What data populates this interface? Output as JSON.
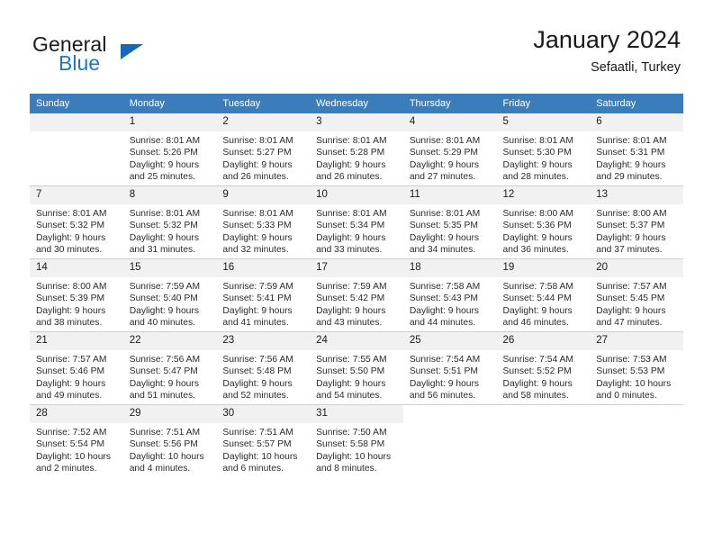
{
  "brand": {
    "name_part1": "General",
    "name_part2": "Blue",
    "triangle_color": "#1669b2",
    "blue_color": "#1f77c2"
  },
  "header": {
    "title": "January 2024",
    "subtitle": "Sefaatli, Turkey"
  },
  "theme": {
    "header_row_bg": "#3b7cbb",
    "daynum_bg": "#f1f1f1",
    "grid_line": "#cfcfcf",
    "text": "#1a1a1a"
  },
  "weekday_headers": [
    "Sunday",
    "Monday",
    "Tuesday",
    "Wednesday",
    "Thursday",
    "Friday",
    "Saturday"
  ],
  "weeks": [
    [
      {
        "day": "",
        "lines": []
      },
      {
        "day": "1",
        "lines": [
          "Sunrise: 8:01 AM",
          "Sunset: 5:26 PM",
          "Daylight: 9 hours",
          "and 25 minutes."
        ]
      },
      {
        "day": "2",
        "lines": [
          "Sunrise: 8:01 AM",
          "Sunset: 5:27 PM",
          "Daylight: 9 hours",
          "and 26 minutes."
        ]
      },
      {
        "day": "3",
        "lines": [
          "Sunrise: 8:01 AM",
          "Sunset: 5:28 PM",
          "Daylight: 9 hours",
          "and 26 minutes."
        ]
      },
      {
        "day": "4",
        "lines": [
          "Sunrise: 8:01 AM",
          "Sunset: 5:29 PM",
          "Daylight: 9 hours",
          "and 27 minutes."
        ]
      },
      {
        "day": "5",
        "lines": [
          "Sunrise: 8:01 AM",
          "Sunset: 5:30 PM",
          "Daylight: 9 hours",
          "and 28 minutes."
        ]
      },
      {
        "day": "6",
        "lines": [
          "Sunrise: 8:01 AM",
          "Sunset: 5:31 PM",
          "Daylight: 9 hours",
          "and 29 minutes."
        ]
      }
    ],
    [
      {
        "day": "7",
        "lines": [
          "Sunrise: 8:01 AM",
          "Sunset: 5:32 PM",
          "Daylight: 9 hours",
          "and 30 minutes."
        ]
      },
      {
        "day": "8",
        "lines": [
          "Sunrise: 8:01 AM",
          "Sunset: 5:32 PM",
          "Daylight: 9 hours",
          "and 31 minutes."
        ]
      },
      {
        "day": "9",
        "lines": [
          "Sunrise: 8:01 AM",
          "Sunset: 5:33 PM",
          "Daylight: 9 hours",
          "and 32 minutes."
        ]
      },
      {
        "day": "10",
        "lines": [
          "Sunrise: 8:01 AM",
          "Sunset: 5:34 PM",
          "Daylight: 9 hours",
          "and 33 minutes."
        ]
      },
      {
        "day": "11",
        "lines": [
          "Sunrise: 8:01 AM",
          "Sunset: 5:35 PM",
          "Daylight: 9 hours",
          "and 34 minutes."
        ]
      },
      {
        "day": "12",
        "lines": [
          "Sunrise: 8:00 AM",
          "Sunset: 5:36 PM",
          "Daylight: 9 hours",
          "and 36 minutes."
        ]
      },
      {
        "day": "13",
        "lines": [
          "Sunrise: 8:00 AM",
          "Sunset: 5:37 PM",
          "Daylight: 9 hours",
          "and 37 minutes."
        ]
      }
    ],
    [
      {
        "day": "14",
        "lines": [
          "Sunrise: 8:00 AM",
          "Sunset: 5:39 PM",
          "Daylight: 9 hours",
          "and 38 minutes."
        ]
      },
      {
        "day": "15",
        "lines": [
          "Sunrise: 7:59 AM",
          "Sunset: 5:40 PM",
          "Daylight: 9 hours",
          "and 40 minutes."
        ]
      },
      {
        "day": "16",
        "lines": [
          "Sunrise: 7:59 AM",
          "Sunset: 5:41 PM",
          "Daylight: 9 hours",
          "and 41 minutes."
        ]
      },
      {
        "day": "17",
        "lines": [
          "Sunrise: 7:59 AM",
          "Sunset: 5:42 PM",
          "Daylight: 9 hours",
          "and 43 minutes."
        ]
      },
      {
        "day": "18",
        "lines": [
          "Sunrise: 7:58 AM",
          "Sunset: 5:43 PM",
          "Daylight: 9 hours",
          "and 44 minutes."
        ]
      },
      {
        "day": "19",
        "lines": [
          "Sunrise: 7:58 AM",
          "Sunset: 5:44 PM",
          "Daylight: 9 hours",
          "and 46 minutes."
        ]
      },
      {
        "day": "20",
        "lines": [
          "Sunrise: 7:57 AM",
          "Sunset: 5:45 PM",
          "Daylight: 9 hours",
          "and 47 minutes."
        ]
      }
    ],
    [
      {
        "day": "21",
        "lines": [
          "Sunrise: 7:57 AM",
          "Sunset: 5:46 PM",
          "Daylight: 9 hours",
          "and 49 minutes."
        ]
      },
      {
        "day": "22",
        "lines": [
          "Sunrise: 7:56 AM",
          "Sunset: 5:47 PM",
          "Daylight: 9 hours",
          "and 51 minutes."
        ]
      },
      {
        "day": "23",
        "lines": [
          "Sunrise: 7:56 AM",
          "Sunset: 5:48 PM",
          "Daylight: 9 hours",
          "and 52 minutes."
        ]
      },
      {
        "day": "24",
        "lines": [
          "Sunrise: 7:55 AM",
          "Sunset: 5:50 PM",
          "Daylight: 9 hours",
          "and 54 minutes."
        ]
      },
      {
        "day": "25",
        "lines": [
          "Sunrise: 7:54 AM",
          "Sunset: 5:51 PM",
          "Daylight: 9 hours",
          "and 56 minutes."
        ]
      },
      {
        "day": "26",
        "lines": [
          "Sunrise: 7:54 AM",
          "Sunset: 5:52 PM",
          "Daylight: 9 hours",
          "and 58 minutes."
        ]
      },
      {
        "day": "27",
        "lines": [
          "Sunrise: 7:53 AM",
          "Sunset: 5:53 PM",
          "Daylight: 10 hours",
          "and 0 minutes."
        ]
      }
    ],
    [
      {
        "day": "28",
        "lines": [
          "Sunrise: 7:52 AM",
          "Sunset: 5:54 PM",
          "Daylight: 10 hours",
          "and 2 minutes."
        ]
      },
      {
        "day": "29",
        "lines": [
          "Sunrise: 7:51 AM",
          "Sunset: 5:56 PM",
          "Daylight: 10 hours",
          "and 4 minutes."
        ]
      },
      {
        "day": "30",
        "lines": [
          "Sunrise: 7:51 AM",
          "Sunset: 5:57 PM",
          "Daylight: 10 hours",
          "and 6 minutes."
        ]
      },
      {
        "day": "31",
        "lines": [
          "Sunrise: 7:50 AM",
          "Sunset: 5:58 PM",
          "Daylight: 10 hours",
          "and 8 minutes."
        ]
      },
      {
        "day": "",
        "lines": []
      },
      {
        "day": "",
        "lines": []
      },
      {
        "day": "",
        "lines": []
      }
    ]
  ]
}
